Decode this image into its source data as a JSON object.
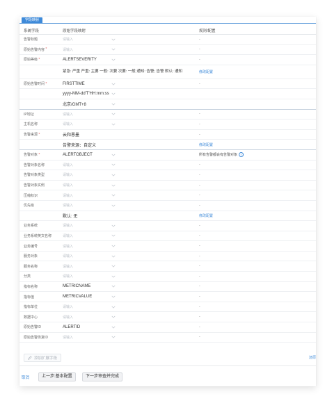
{
  "tab": {
    "label": "字段映射"
  },
  "table": {
    "headers": {
      "system_field": "系统字段",
      "source_mapping": "原始字段映射",
      "rule": "规则/配置"
    },
    "rows": [
      {
        "label": "告警标题",
        "field": "",
        "placeholder": "请输入",
        "rule": "-"
      },
      {
        "label": "原始告警内容",
        "required": true,
        "field": "",
        "placeholder": "请输入",
        "rule": "-"
      },
      {
        "label": "原始等级",
        "required": true,
        "field": "ALERTSEVERITY",
        "placeholder": "",
        "rule": "-"
      },
      {
        "label": "",
        "text": "紧急: 严重 严重: 主要 一般: 次要 次要: 一般 通知: 告警; 告警 默认: 通知",
        "link": "修改配置"
      },
      {
        "label": "原始告警时间",
        "required": true,
        "field": "FIRSTTIME",
        "placeholder": "",
        "rule": "-"
      },
      {
        "label": "",
        "field": "yyyy-MM-dd'T'HH:mm:ss",
        "placeholder": "",
        "rule": ""
      },
      {
        "label": "",
        "field": "北京/GMT+8",
        "placeholder": "",
        "rule": "",
        "sep": true
      },
      {
        "label": "IP地址",
        "field": "",
        "placeholder": "请输入",
        "rule": "-"
      },
      {
        "label": "主机名称",
        "field": "",
        "placeholder": "请输入",
        "rule": "-"
      },
      {
        "label": "告警来源",
        "required": true,
        "text": "云和恩墨",
        "rule": "-"
      },
      {
        "label": "",
        "text": "告警来源：自定义",
        "link": "修改配置",
        "sep": true
      },
      {
        "label": "告警对象",
        "required": true,
        "field": "ALERTOBJECT",
        "placeholder": "",
        "rule": "所有告警都会有告警对象",
        "help": true
      },
      {
        "label": "告警对象名称",
        "field": "",
        "placeholder": "请输入",
        "rule": "-"
      },
      {
        "label": "告警对象类型",
        "field": "",
        "placeholder": "请输入",
        "rule": "-"
      },
      {
        "label": "告警对象实例",
        "field": "",
        "placeholder": "请输入",
        "rule": "-"
      },
      {
        "label": "压缩标识",
        "field": "",
        "placeholder": "请输入",
        "rule": "-"
      },
      {
        "label": "优先级",
        "field": "",
        "placeholder": "请输入",
        "rule": "-"
      },
      {
        "label": "",
        "text": "默认: 无",
        "link": "修改配置"
      },
      {
        "label": "业务系统",
        "field": "",
        "placeholder": "请输入",
        "rule": "-"
      },
      {
        "label": "业务系统英文名称",
        "field": "",
        "placeholder": "请输入",
        "rule": "-"
      },
      {
        "label": "业务编号",
        "field": "",
        "placeholder": "请输入",
        "rule": "-"
      },
      {
        "label": "服务对象",
        "field": "",
        "placeholder": "请输入",
        "rule": "-"
      },
      {
        "label": "服务名称",
        "field": "",
        "placeholder": "请输入",
        "rule": "-"
      },
      {
        "label": "分类",
        "field": "",
        "placeholder": "请输入",
        "rule": "-"
      },
      {
        "label": "指标名称",
        "field": "METRICNAME",
        "placeholder": "",
        "rule": "-"
      },
      {
        "label": "指标值",
        "field": "METRICVALUE",
        "placeholder": "",
        "rule": "-"
      },
      {
        "label": "指标单位",
        "field": "",
        "placeholder": "请输入",
        "rule": "-"
      },
      {
        "label": "数据中心",
        "field": "",
        "placeholder": "请输入",
        "rule": "-"
      },
      {
        "label": "原始告警ID",
        "field": "ALERTID",
        "placeholder": "",
        "rule": "-"
      },
      {
        "label": "原始告警恢复ID",
        "field": "",
        "placeholder": "请输入",
        "rule": "-"
      }
    ]
  },
  "add_field": {
    "label": "添加扩展字段"
  },
  "side_link": "还原",
  "footer": {
    "cancel": "取消",
    "prev": "上一步:基本配置",
    "next": "下一步审查并完成"
  },
  "colors": {
    "accent": "#3e8ad9",
    "placeholder": "#b8bec6",
    "separator": "#c8d3df"
  },
  "icons": {
    "chevron": "chevron-down-icon",
    "pencil": "pencil-icon",
    "help": "help-circle-icon"
  }
}
